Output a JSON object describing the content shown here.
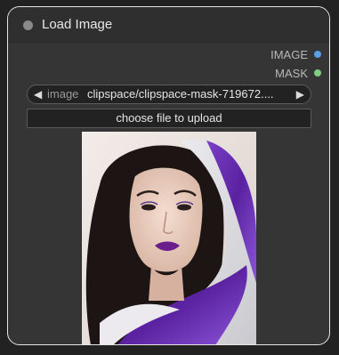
{
  "node": {
    "title": "Load Image",
    "outputs": [
      {
        "label": "IMAGE",
        "color": "#5aa0e6"
      },
      {
        "label": "MASK",
        "color": "#7ccf7c"
      }
    ]
  },
  "widgets": {
    "image_combo": {
      "label": "image",
      "value": "clipspace/clipspace-mask-719672....",
      "left_arrow_icon": "triangle-left-icon",
      "right_arrow_icon": "triangle-right-icon"
    },
    "upload_button_label": "choose file to upload"
  },
  "preview": {
    "description_icon": "portrait-image",
    "accent_color": "#6a2fb0"
  },
  "colors": {
    "node_border": "#e6e6e6",
    "node_body": "#353535",
    "canvas": "#222222"
  }
}
